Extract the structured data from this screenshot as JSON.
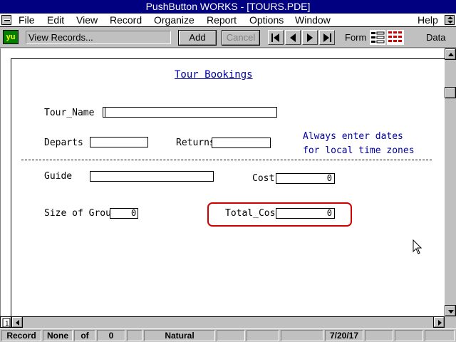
{
  "window": {
    "title": "PushButton WORKS - [TOURS.PDE]"
  },
  "menubar": {
    "items": [
      {
        "label": "File"
      },
      {
        "label": "Edit"
      },
      {
        "label": "View"
      },
      {
        "label": "Record"
      },
      {
        "label": "Organize"
      },
      {
        "label": "Report"
      },
      {
        "label": "Options"
      },
      {
        "label": "Window"
      },
      {
        "label": "Help"
      }
    ]
  },
  "toolbar": {
    "logo_text": "yu",
    "view_text": "View Records...",
    "add_label": "Add",
    "cancel_label": "Cancel",
    "form_label": "Form",
    "data_label": "Data"
  },
  "form": {
    "title": "Tour Bookings",
    "tour_name_label": "Tour_Name",
    "tour_name_value": "",
    "departs_label": "Departs",
    "departs_value": "",
    "returns_label": "Returns",
    "returns_value": "",
    "note_line1": "Always enter dates",
    "note_line2": "for local time zones",
    "guide_label": "Guide",
    "guide_value": "",
    "cost_label": "Cost",
    "cost_value": "0",
    "size_label": "Size of Group",
    "size_value": "0",
    "total_label": "Total_Cost",
    "total_value": "0"
  },
  "statusbar": {
    "record_label": "Record",
    "record_value": "None",
    "of_label": "of",
    "of_value": "0",
    "mode": "Natural",
    "date": "7/20/17"
  },
  "colors": {
    "titlebar": "#000080",
    "form_title": "#0000aa",
    "highlight": "#d00000"
  }
}
